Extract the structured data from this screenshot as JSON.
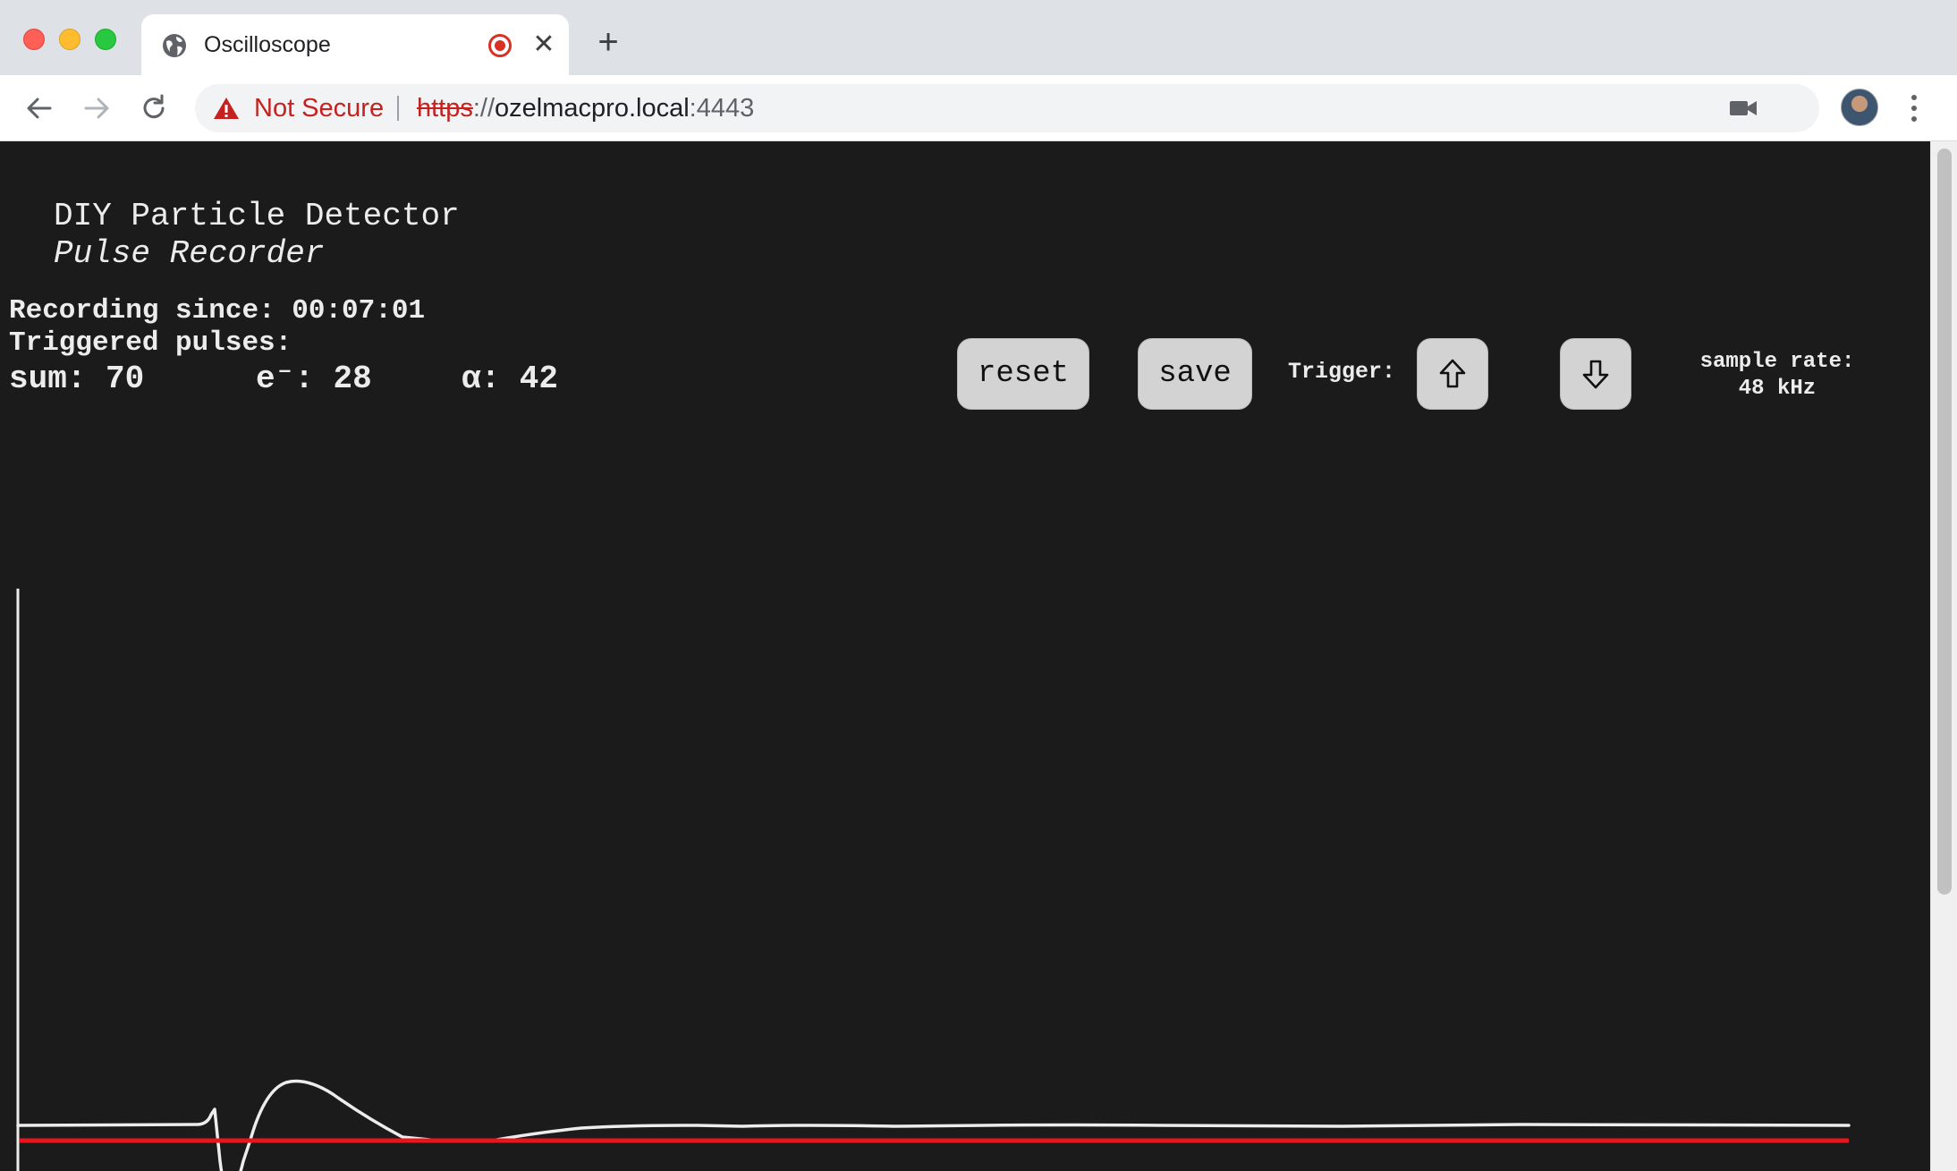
{
  "browser": {
    "tab_title": "Oscilloscope",
    "tab_close_glyph": "✕",
    "new_tab_glyph": "+",
    "security_label": "Not Secure",
    "url_scheme": "https",
    "url_separator": "://",
    "url_host": "ozelmacpro.local",
    "url_port": ":4443",
    "icons": [
      "globe-icon",
      "record-icon",
      "close-icon",
      "plus-icon",
      "back-arrow-icon",
      "forward-arrow-icon",
      "reload-icon",
      "warning-icon",
      "camera-icon",
      "star-icon",
      "avatar",
      "kebab-menu-icon"
    ]
  },
  "page": {
    "title": "DIY Particle Detector",
    "subtitle": "Pulse Recorder",
    "recording_since": "Recording since: 00:07:01",
    "triggered_pulses": "Triggered pulses:",
    "counts": {
      "sum": "sum: 70",
      "electrons": "e⁻: 28",
      "alpha": "α: 42"
    },
    "buttons": {
      "reset": "reset",
      "save": "save"
    },
    "trigger_label": "Trigger:",
    "sample_rate_label": "sample rate:",
    "sample_rate_value": "48 kHz",
    "colors": {
      "background": "#1b1b1b",
      "trace": "#ececec",
      "trigger_line": "#e8151b"
    }
  }
}
